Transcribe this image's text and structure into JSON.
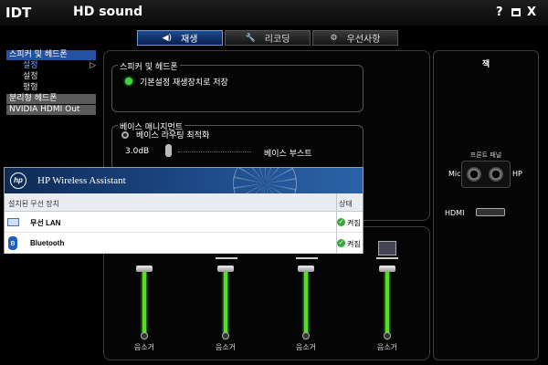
{
  "app": {
    "brand": "IDT",
    "title": "HD sound",
    "help_label": "?",
    "close_label": "X"
  },
  "tabs": [
    {
      "label": "재생",
      "icon": "speaker-icon",
      "active": true
    },
    {
      "label": "리코딩",
      "icon": "wrench-icon",
      "active": false
    },
    {
      "label": "우선사항",
      "icon": "gear-icon",
      "active": false
    }
  ],
  "sidebar": {
    "items": [
      {
        "label": "스피커 및 헤드폰",
        "kind": "head"
      },
      {
        "label": "설정",
        "kind": "sub-selected"
      },
      {
        "label": "설정",
        "kind": "sub"
      },
      {
        "label": "평형",
        "kind": "sub"
      },
      {
        "label": "분리형 헤드폰",
        "kind": "gray"
      },
      {
        "label": "NVIDIA HDMI Out",
        "kind": "gray"
      }
    ],
    "arrow": "▷"
  },
  "speaker_group": {
    "title": "스피커 및 헤드폰",
    "option_label": "기본설정 재생장치로 저장"
  },
  "bass_group": {
    "title": "베이스 매니지먼트",
    "option_label": "베이스 라우팅 최적화",
    "value": "3.0dB",
    "right_label": "베이스 부스트"
  },
  "jack_panel": {
    "title": "잭",
    "subtitle": "프론트 패널",
    "mic_label": "Mic",
    "hp_label": "HP",
    "hdmi_label": "HDMI"
  },
  "sliders": [
    {
      "mute_label": "음소거",
      "level": 1.0
    },
    {
      "mute_label": "음소거",
      "level": 1.0
    },
    {
      "mute_label": "음소거",
      "level": 1.0
    },
    {
      "mute_label": "음소거",
      "level": 1.0
    }
  ],
  "hp_dialog": {
    "logo": "hp",
    "title": "HP Wireless Assistant",
    "col_device": "설치된 무선 장치",
    "col_status": "상태",
    "rows": [
      {
        "name": "무선 LAN",
        "icon": "laptop-wifi-icon",
        "status": "켜짐"
      },
      {
        "name": "Bluetooth",
        "icon": "bluetooth-icon",
        "status": "켜짐"
      }
    ]
  },
  "colors": {
    "accent_blue": "#2451a0",
    "slider_green": "#58e01e",
    "status_green": "#3aa83a"
  }
}
